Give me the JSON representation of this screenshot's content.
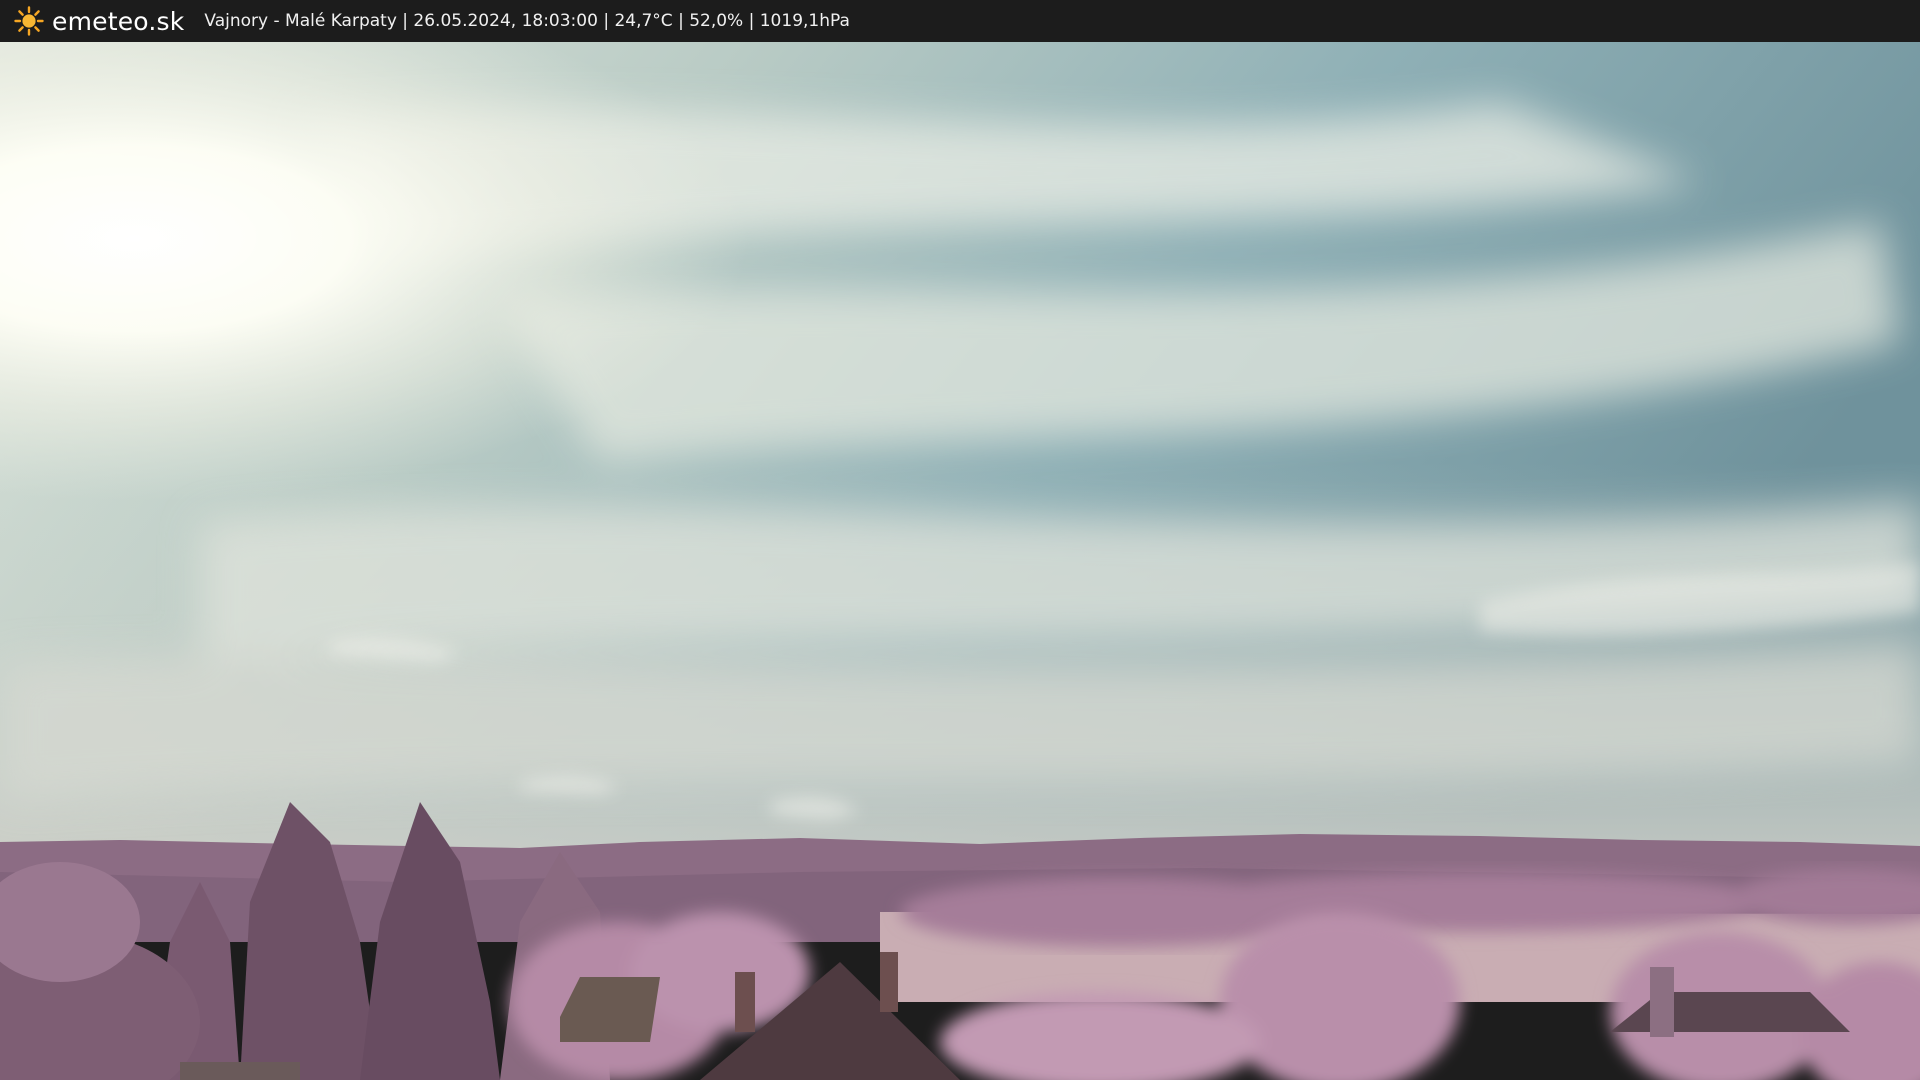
{
  "header": {
    "brand": "emeteo.sk",
    "brand_icon": "sun-icon",
    "caption": "Vajnory - Malé Karpaty | 26.05.2024, 18:03:00 | 24,7°C | 52,0% | 1019,1hPa"
  },
  "colors": {
    "bar_background": "#1c1c1c",
    "sun_icon": "#f6a623",
    "sky_blue": "#6f9aa6",
    "cloud_light": "#e6ebe0",
    "hills": "#8a6b82",
    "foliage": "#b58aa6"
  }
}
